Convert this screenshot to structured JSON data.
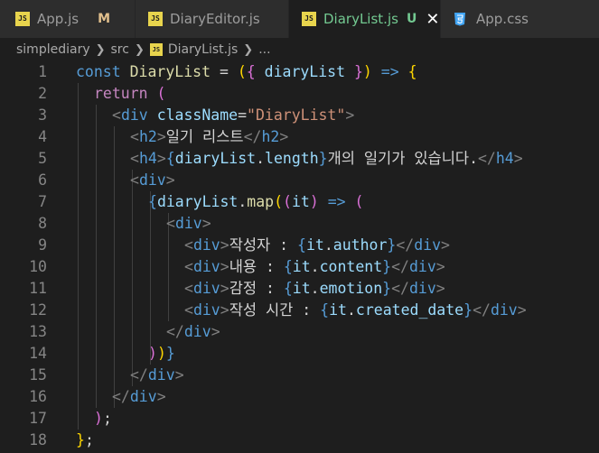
{
  "tabs": [
    {
      "label": "App.js",
      "status": "M",
      "icon": "js-file-icon"
    },
    {
      "label": "DiaryEditor.js",
      "icon": "js-file-icon"
    },
    {
      "label": "DiaryList.js",
      "status": "U",
      "icon": "js-file-icon",
      "active": true
    },
    {
      "label": "App.css",
      "icon": "css-file-icon"
    }
  ],
  "breadcrumb": {
    "folder1": "simplediary",
    "folder2": "src",
    "file": "DiaryList.js",
    "more": "..."
  },
  "line_numbers": [
    "1",
    "2",
    "3",
    "4",
    "5",
    "6",
    "7",
    "8",
    "9",
    "10",
    "11",
    "12",
    "13",
    "14",
    "15",
    "16",
    "17",
    "18"
  ],
  "code": {
    "l1": [
      "const",
      " ",
      "DiaryList",
      " = ",
      "(",
      "{",
      " ",
      "diaryList",
      " ",
      "}",
      ")",
      " => ",
      "{"
    ],
    "l2": [
      "return",
      " ",
      "("
    ],
    "l3": [
      "<",
      "div",
      " ",
      "className",
      "=",
      "\"DiaryList\"",
      ">"
    ],
    "l4": [
      "<",
      "h2",
      ">",
      "일기 리스트",
      "</",
      "h2",
      ">"
    ],
    "l5": [
      "<",
      "h4",
      ">",
      "{",
      "diaryList",
      ".",
      "length",
      "}",
      "개의 일기가 있습니다.",
      "</",
      "h4",
      ">"
    ],
    "l6": [
      "<",
      "div",
      ">"
    ],
    "l7": [
      "{",
      "diaryList",
      ".",
      "map",
      "(",
      "(",
      "it",
      ")",
      " => ",
      "("
    ],
    "l8": [
      "<",
      "div",
      ">"
    ],
    "l9": [
      "<",
      "div",
      ">",
      "작성자 : ",
      "{",
      "it",
      ".",
      "author",
      "}",
      "</",
      "div",
      ">"
    ],
    "l10": [
      "<",
      "div",
      ">",
      "내용 : ",
      "{",
      "it",
      ".",
      "content",
      "}",
      "</",
      "div",
      ">"
    ],
    "l11": [
      "<",
      "div",
      ">",
      "감정 : ",
      "{",
      "it",
      ".",
      "emotion",
      "}",
      "</",
      "div",
      ">"
    ],
    "l12": [
      "<",
      "div",
      ">",
      "작성 시간 : ",
      "{",
      "it",
      ".",
      "created_date",
      "}",
      "</",
      "div",
      ">"
    ],
    "l13": [
      "</",
      "div",
      ">"
    ],
    "l14": [
      ")",
      ")",
      "}"
    ],
    "l15": [
      "</",
      "div",
      ">"
    ],
    "l16": [
      "</",
      "div",
      ">"
    ],
    "l17": [
      ")",
      ";"
    ],
    "l18": [
      "}",
      ";"
    ]
  },
  "colors": {
    "keyword": "#569cd6",
    "control": "#c586c0",
    "function": "#dcdcaa",
    "variable": "#9cdcfe",
    "string": "#ce9178",
    "tag_bracket": "#808080",
    "untracked": "#73c991"
  }
}
